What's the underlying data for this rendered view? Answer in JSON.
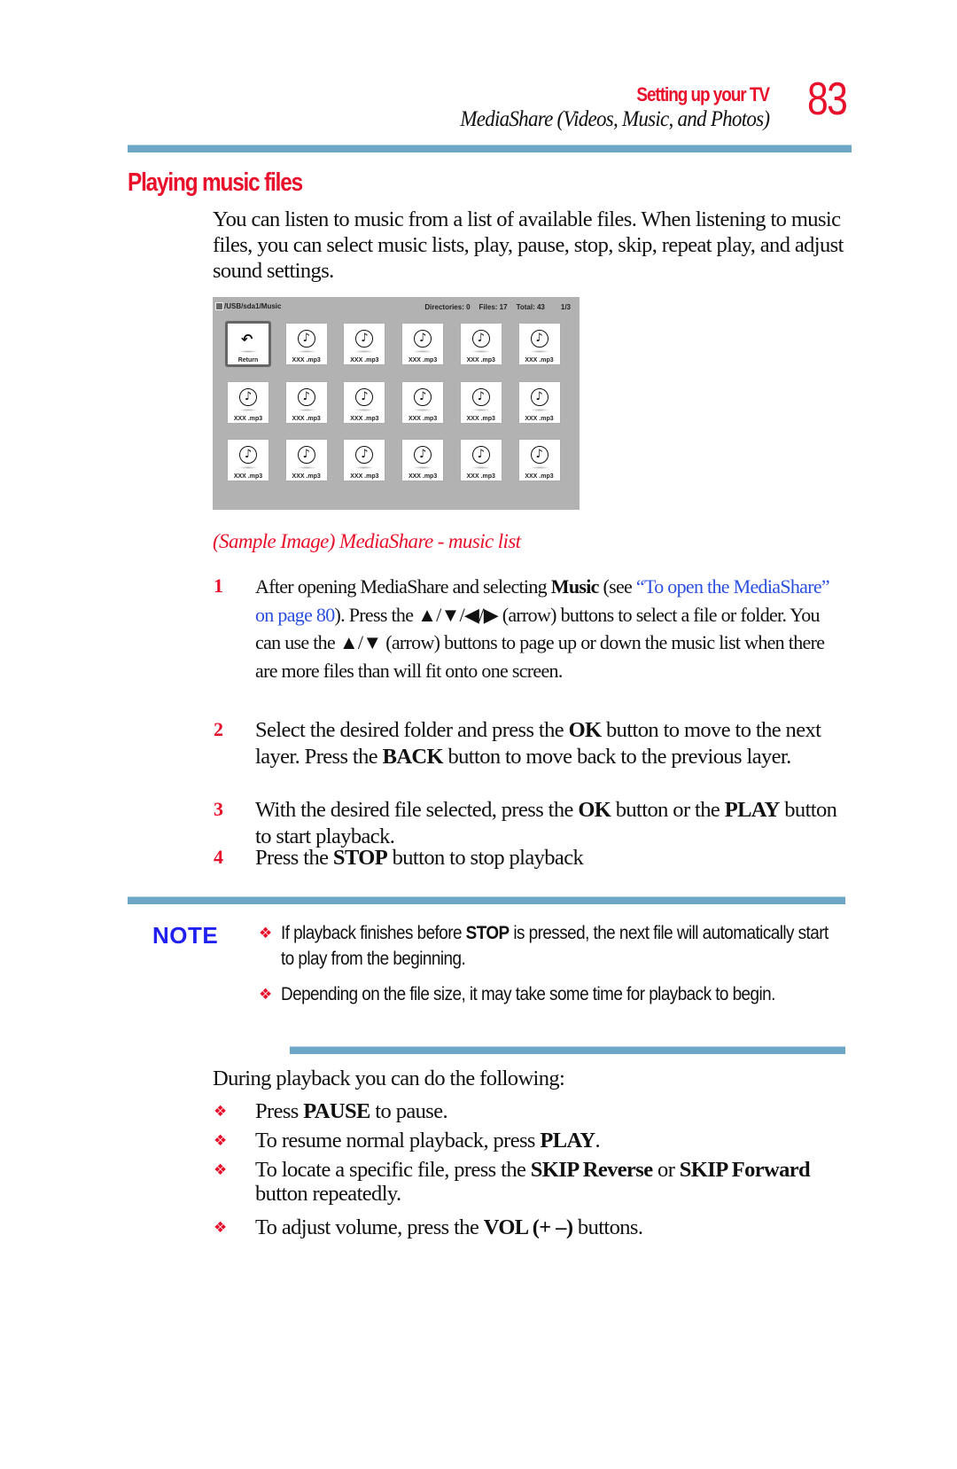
{
  "header": {
    "section": "Setting up your TV",
    "subsection": "MediaShare (Videos, Music, and Photos)",
    "page_number": "83"
  },
  "title": "Playing music files",
  "intro": "You can listen to music from a list of available files. When listening to music files, you can select music lists, play, pause, stop, skip, repeat play, and adjust sound settings.",
  "mediashare": {
    "path": "/USB/sda1/Music",
    "directories": "Directories: 0",
    "files": "Files: 17",
    "total": "Total: 43",
    "page": "1/3",
    "tiles": [
      {
        "label": "Return",
        "icon": "return-icon"
      },
      {
        "label": "XXX .mp3",
        "icon": "music-note-icon"
      },
      {
        "label": "XXX .mp3",
        "icon": "music-note-icon"
      },
      {
        "label": "XXX .mp3",
        "icon": "music-note-icon"
      },
      {
        "label": "XXX .mp3",
        "icon": "music-note-icon"
      },
      {
        "label": "XXX .mp3",
        "icon": "music-note-icon"
      },
      {
        "label": "XXX .mp3",
        "icon": "music-note-icon"
      },
      {
        "label": "XXX .mp3",
        "icon": "music-note-icon"
      },
      {
        "label": "XXX .mp3",
        "icon": "music-note-icon"
      },
      {
        "label": "XXX .mp3",
        "icon": "music-note-icon"
      },
      {
        "label": "XXX .mp3",
        "icon": "music-note-icon"
      },
      {
        "label": "XXX .mp3",
        "icon": "music-note-icon"
      },
      {
        "label": "XXX .mp3",
        "icon": "music-note-icon"
      },
      {
        "label": "XXX .mp3",
        "icon": "music-note-icon"
      },
      {
        "label": "XXX .mp3",
        "icon": "music-note-icon"
      },
      {
        "label": "XXX .mp3",
        "icon": "music-note-icon"
      },
      {
        "label": "XXX .mp3",
        "icon": "music-note-icon"
      },
      {
        "label": "XXX .mp3",
        "icon": "music-note-icon"
      }
    ]
  },
  "caption": "(Sample Image) MediaShare - music list",
  "steps": [
    {
      "number": "1",
      "parts": [
        {
          "t": "After opening MediaShare and selecting "
        },
        {
          "t": "Music",
          "b": true
        },
        {
          "t": " (see "
        },
        {
          "t": "“To open the MediaShare” on page 80",
          "link": true
        },
        {
          "t": "). Press the ▲/▼/◀/▶ (arrow) buttons to select a file or folder. You can use the "
        },
        {
          "t": "▲/▼ (arrow)",
          "b": false
        },
        {
          "t": " buttons to page up or down the music list when there are more files than will fit onto one screen."
        }
      ]
    },
    {
      "number": "2",
      "parts": [
        {
          "t": "Select the desired folder and press the "
        },
        {
          "t": "OK",
          "b": true
        },
        {
          "t": " button to move to the next layer. Press the "
        },
        {
          "t": "BACK",
          "b": true
        },
        {
          "t": " button to move back to the previous layer."
        }
      ]
    },
    {
      "number": "3",
      "parts": [
        {
          "t": "With the desired file selected, press the "
        },
        {
          "t": "OK",
          "b": true
        },
        {
          "t": " button or the "
        },
        {
          "t": "PLAY",
          "b": true
        },
        {
          "t": " button to start playback."
        }
      ]
    },
    {
      "number": "4",
      "parts": [
        {
          "t": "Press the "
        },
        {
          "t": "STOP",
          "b": true
        },
        {
          "t": " button to stop playback"
        }
      ]
    }
  ],
  "note": {
    "label": "NOTE",
    "items": [
      {
        "parts": [
          {
            "t": "If playback finishes before "
          },
          {
            "t": "STOP",
            "b": true
          },
          {
            "t": " is pressed, the next file will automatically start to play from the beginning."
          }
        ]
      },
      {
        "parts": [
          {
            "t": "Depending on the file size, it may take some time for playback to begin."
          }
        ]
      }
    ]
  },
  "during": {
    "lead": "During playback you can do the following:",
    "items": [
      {
        "parts": [
          {
            "t": "Press "
          },
          {
            "t": "PAUSE",
            "b": true
          },
          {
            "t": " to pause."
          }
        ]
      },
      {
        "parts": [
          {
            "t": "To resume normal playback, press "
          },
          {
            "t": "PLAY",
            "b": true
          },
          {
            "t": "."
          }
        ]
      },
      {
        "parts": [
          {
            "t": "To locate a specific file, press the "
          },
          {
            "t": "SKIP Reverse",
            "b": true
          },
          {
            "t": " or "
          },
          {
            "t": "SKIP Forward",
            "b": true
          },
          {
            "t": " button repeatedly."
          }
        ]
      },
      {
        "parts": [
          {
            "t": "To adjust volume, press the "
          },
          {
            "t": "VOL (+ –)",
            "b": true
          },
          {
            "t": " buttons."
          }
        ]
      }
    ]
  },
  "bullet_glyph": "❖",
  "colors": {
    "accent_red": "#e8102a",
    "rule_blue": "#6ea6c6",
    "note_blue": "#2020f0",
    "link_blue": "#2a4fe0"
  }
}
